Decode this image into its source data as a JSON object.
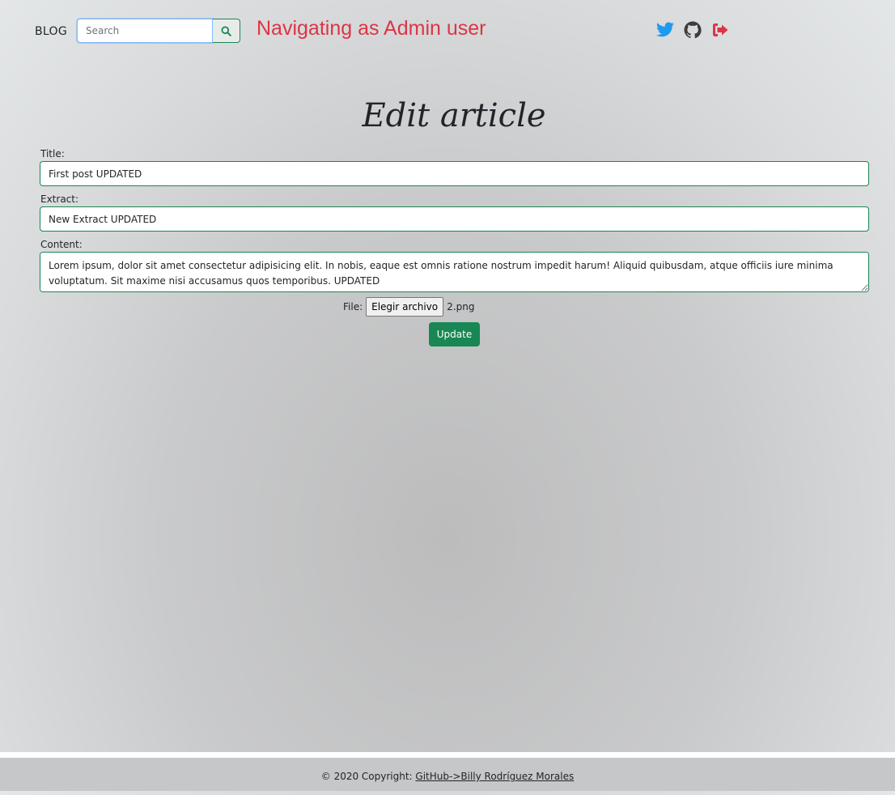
{
  "navbar": {
    "brand": "BLOG",
    "search_placeholder": "Search",
    "search_icon": "search-icon",
    "admin_message": "Navigating as Admin user",
    "icons": [
      "twitter-icon",
      "github-icon",
      "logout-icon"
    ]
  },
  "form": {
    "title": "Edit article",
    "title_label": "Title:",
    "title_value": "First post UPDATED",
    "extract_label": "Extract:",
    "extract_value": "New Extract UPDATED",
    "content_label": "Content:",
    "content_value": "Lorem ipsum, dolor sit amet consectetur adipisicing elit. In nobis, eaque est omnis ratione nostrum impedit harum! Aliquid quibusdam, atque officiis iure minima voluptatum. Sit maxime nisi accusamus quos temporibus. UPDATED",
    "file_label": "File:",
    "file_button": "Elegir archivo",
    "file_name": "2.png",
    "submit_label": "Update"
  },
  "footer": {
    "copyright": "© 2020 Copyright: ",
    "link_text": "GitHub->Billy Rodríguez Morales"
  },
  "colors": {
    "accent": "#198754",
    "danger": "#dc3545",
    "twitter": "#1d9bf0",
    "github": "#3d3d3d"
  }
}
